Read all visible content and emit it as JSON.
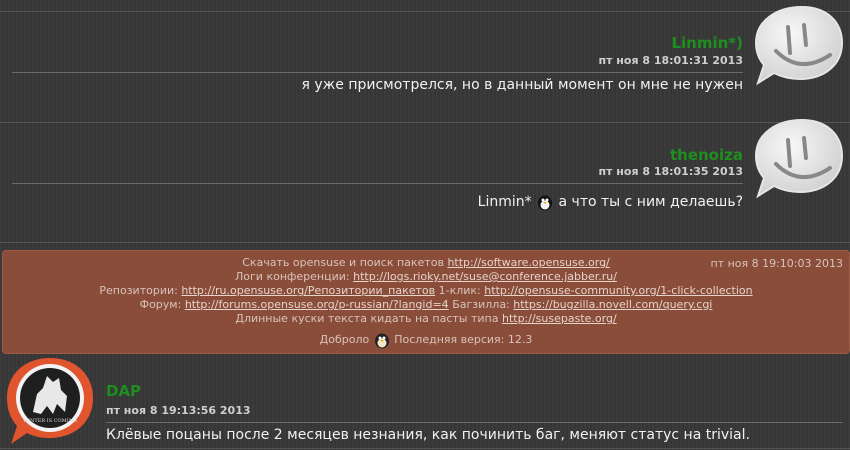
{
  "messages": [
    {
      "nick": "Linmin*)",
      "time": "пт ноя 8 18:01:31 2013",
      "text": "я уже присмотрелся, но в данный момент он мне не нужен"
    },
    {
      "nick": "thenoiza",
      "time": "пт ноя 8 18:01:35 2013",
      "mention": "Linmin*",
      "text": "а что ты с ним делаешь?"
    }
  ],
  "system": {
    "time": "пт ноя 8 19:10:03 2013",
    "line1_label": "Скачать opensuse и поиск пакетов",
    "line1_link": "http://software.opensuse.org/",
    "line2_label": "Логи конференции:",
    "line2_link": "http://logs.rioky.net/suse@conference.jabber.ru/",
    "line3_label": "Репозитории:",
    "line3_link1": "http://ru.opensuse.org/Репозитории_пакетов",
    "line3_mid": "1-клик:",
    "line3_link2": "http://opensuse-community.org/1-click-collection",
    "line4_label": "Форум:",
    "line4_link1": "http://forums.opensuse.org/p-russian/?langid=4",
    "line4_mid": "Багзилла:",
    "line4_link2": "https://bugzilla.novell.com/query.cgi",
    "line5_label": "Длинные куски текста кидать на пасты типа",
    "line5_link": "http://susepaste.org/",
    "line6_a": "Доброло",
    "line6_b": "Последняя версия: 12.3"
  },
  "last_message": {
    "nick": "DAP",
    "time": "пт ноя 8 19:13:56 2013",
    "text": "Клёвые поцаны после 2 месяцев незнания, как починить баг, меняют статус на trivial.",
    "avatar_text": "WINTER IS COMING"
  },
  "icons": {
    "smiley_avatar": "smiley-speech-bubble-icon",
    "penguin_emoticon": "penguin-emoticon-icon",
    "house_avatar": "house-sigil-avatar-icon"
  },
  "colors": {
    "nick": "#1e8f1e",
    "system_bg": "#8a4d3a",
    "avatar_orange": "#e0542e"
  }
}
